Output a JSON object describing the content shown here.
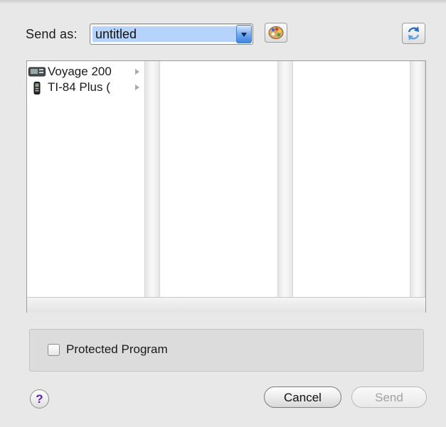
{
  "send_as": {
    "label": "Send as:",
    "value": "untitled"
  },
  "toolbar": {
    "palette_icon": "palette-icon",
    "refresh_icon": "refresh-icon"
  },
  "browser": {
    "devices": [
      {
        "name": "Voyage 200",
        "icon": "voyage-calculator-icon"
      },
      {
        "name": "TI-84 Plus (",
        "icon": "graphing-calculator-icon"
      }
    ]
  },
  "options": {
    "protected_label": "Protected Program",
    "protected_checked": false
  },
  "footer": {
    "help_label": "?",
    "cancel_label": "Cancel",
    "send_label": "Send",
    "send_enabled": false
  },
  "colors": {
    "selection": "#b5d3fb",
    "combo_button": "#3f86e6",
    "help_glyph": "#5a24a8"
  }
}
